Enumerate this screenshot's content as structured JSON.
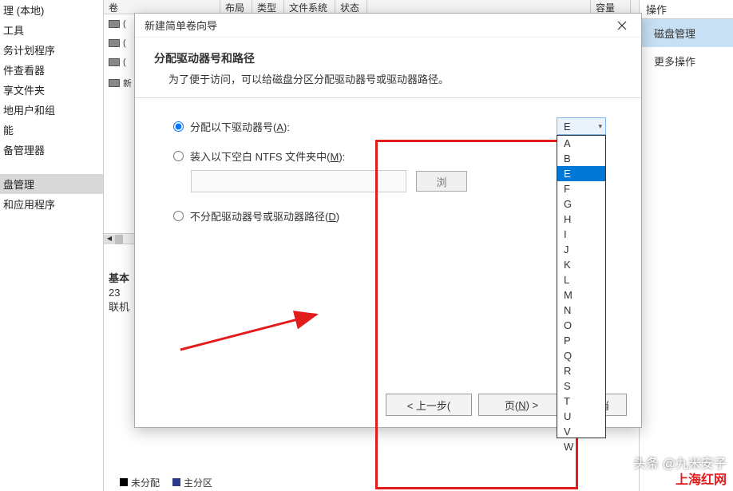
{
  "nav": {
    "items": [
      "理 (本地)",
      "工具",
      "务计划程序",
      "件查看器",
      "享文件夹",
      "地用户和组",
      "能",
      "备管理器",
      "",
      "盘管理",
      "和应用程序"
    ]
  },
  "grid": {
    "headers": [
      "卷",
      "布局",
      "类型",
      "文件系统",
      "状态",
      "容量"
    ]
  },
  "disks": {
    "count": 4,
    "info_title": "基本",
    "info_size": "23",
    "info_status": "联机"
  },
  "right": {
    "header": "操作",
    "active": "磁盘管理",
    "more": "更多操作"
  },
  "dialog": {
    "title": "新建简单卷向导",
    "heading": "分配驱动器号和路径",
    "subtext": "为了便于访问，可以给磁盘分区分配驱动器号或驱动器路径。",
    "opt1_pre": "分配以下驱动器号(",
    "opt1_u": "A",
    "opt1_post": "):",
    "opt2_pre": "装入以下空白 NTFS 文件夹中(",
    "opt2_u": "M",
    "opt2_post": "):",
    "opt3_pre": "不分配驱动器号或驱动器路径(",
    "opt3_u": "D",
    "opt3_post": ")",
    "browse": "浏",
    "selected_letter": "E",
    "letters": [
      "A",
      "B",
      "E",
      "F",
      "G",
      "H",
      "I",
      "J",
      "K",
      "L",
      "M",
      "N",
      "O",
      "P",
      "Q",
      "R",
      "S",
      "T",
      "U",
      "V",
      "W"
    ],
    "back_pre": "< 上一步(",
    "back_post": ")",
    "next_pre": "页(",
    "next_u": "N",
    "next_post": ") >",
    "cancel": "取消"
  },
  "legend": {
    "a": "未分配",
    "b": "主分区"
  },
  "attr": {
    "a": "头条 @九米安子",
    "b": "上海红网"
  }
}
